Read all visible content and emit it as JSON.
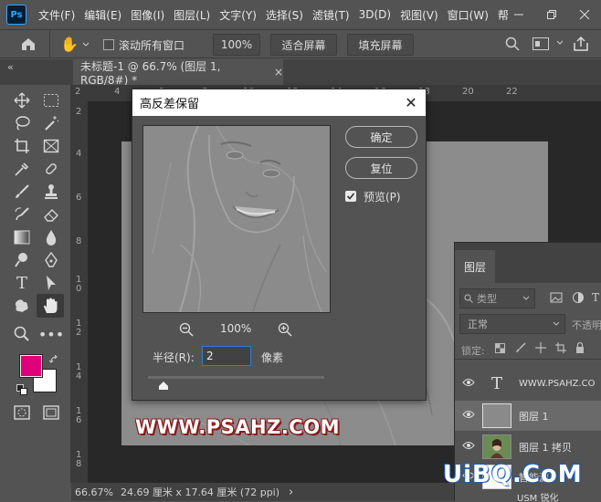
{
  "app": {
    "logo": "Ps"
  },
  "menu": {
    "items": [
      "文件(F)",
      "编辑(E)",
      "图像(I)",
      "图层(L)",
      "文字(Y)",
      "选择(S)",
      "滤镜(T)",
      "3D(D)",
      "视图(V)",
      "窗口(W)",
      "帮"
    ]
  },
  "options_bar": {
    "scroll_all_windows": "滚动所有窗口",
    "zoom_value": "100%",
    "fit_screen": "适合屏幕",
    "fill_screen": "填充屏幕"
  },
  "tabs": {
    "collapse": "«",
    "document_tab": "未标题-1 @ 66.7% (图层 1, RGB/8#) *",
    "close": "×"
  },
  "rulers": {
    "top_ticks": [
      "2",
      "4",
      "6",
      "8",
      "10",
      "12",
      "14",
      "16",
      "18",
      "20",
      "22"
    ],
    "left_ticks": [
      "2",
      "4",
      "6",
      "8",
      "1",
      "0",
      "1",
      "2",
      "1",
      "4",
      "1",
      "6",
      "1",
      "8"
    ]
  },
  "dialog": {
    "title": "高反差保留",
    "close": "✕",
    "ok": "确定",
    "reset": "复位",
    "preview_label": "预览(P)",
    "preview_checked": true,
    "zoom": "100%",
    "radius_label": "半径(R):",
    "radius_value": "2",
    "radius_unit": "像素",
    "slider_value_fraction": 0.09
  },
  "watermark": "WWW.PSAHZ.COM",
  "status": {
    "zoom": "66.67%",
    "doc_info": "24.69 厘米 x 17.64 厘米 (72 ppi)",
    "arrow": "›"
  },
  "layers_panel": {
    "tab": "图层",
    "kind_placeholder": "类型",
    "blend_mode": "正常",
    "opacity_label": "不透明",
    "lock_label": "锁定:",
    "layers": [
      {
        "name": "WWW.PSAHZ.CO",
        "type": "text"
      },
      {
        "name": "图层 1",
        "type": "pixel"
      },
      {
        "name": "图层 1 拷贝",
        "type": "photo"
      },
      {
        "name": "智能滤",
        "type": "smart-filter"
      },
      {
        "name": "USM 锐化",
        "type": "filter"
      }
    ]
  },
  "site_watermark": "UiBQ.CoM",
  "colors": {
    "foreground": "#e0007a",
    "background": "#ffffff",
    "accent": "#31a8ff"
  }
}
